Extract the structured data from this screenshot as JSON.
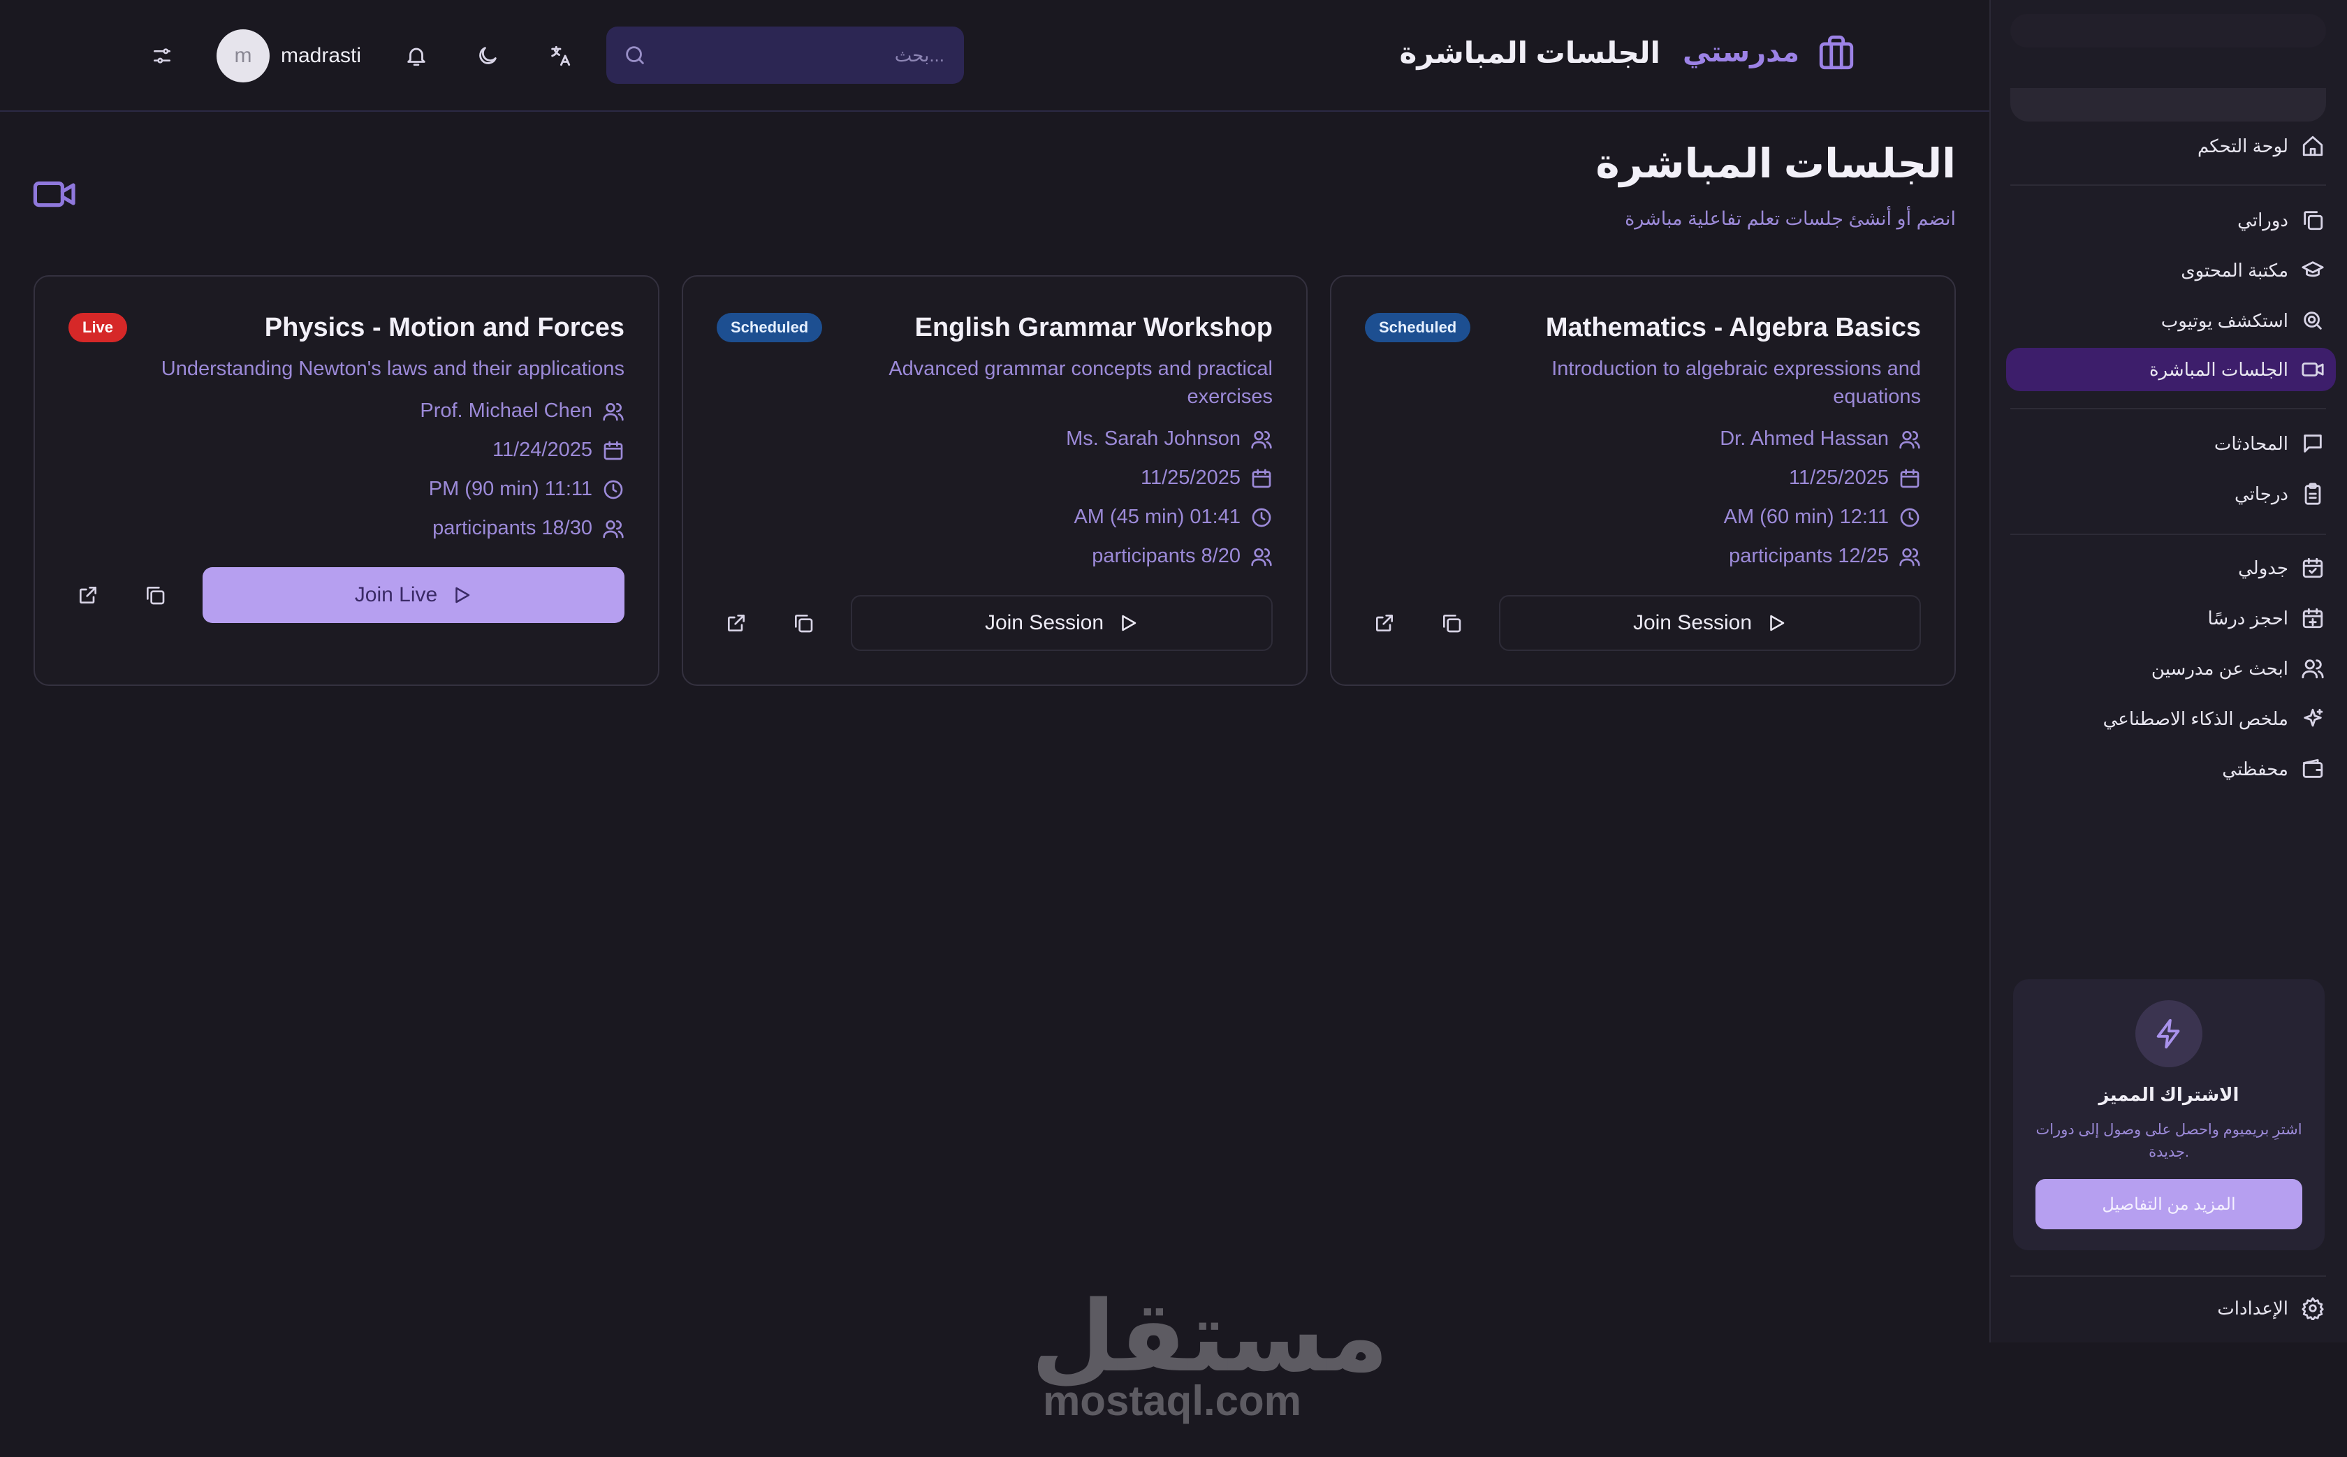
{
  "header": {
    "brand_name": "مدرستي",
    "page_title": "الجلسات المباشرة",
    "search_placeholder": "بحث...",
    "user_initial": "m",
    "user_name": "madrasti"
  },
  "sidebar": {
    "items": [
      {
        "label": "لوحة التحكم",
        "icon": "home-icon"
      },
      {
        "label": "دوراتي",
        "icon": "copy-icon"
      },
      {
        "label": "مكتبة المحتوى",
        "icon": "graduation-cap-icon"
      },
      {
        "label": "استكشف يوتيوب",
        "icon": "search-zoom-icon"
      },
      {
        "label": "الجلسات المباشرة",
        "icon": "video-icon",
        "active": true
      },
      {
        "label": "المحادثات",
        "icon": "message-icon"
      },
      {
        "label": "درجاتي",
        "icon": "clipboard-icon"
      },
      {
        "label": "جدولي",
        "icon": "calendar-check-icon"
      },
      {
        "label": "احجز درسًا",
        "icon": "calendar-plus-icon"
      },
      {
        "label": "ابحث عن مدرسين",
        "icon": "users-icon"
      },
      {
        "label": "ملخص الذكاء الاصطناعي",
        "icon": "sparkles-icon"
      },
      {
        "label": "محفظتي",
        "icon": "wallet-icon"
      }
    ],
    "promo": {
      "title": "الاشتراك المميز",
      "description": "اشترِ بريميوم واحصل على وصول إلى دورات جديدة.",
      "button": "المزيد من التفاصيل"
    },
    "settings_label": "الإعدادات"
  },
  "main": {
    "title": "الجلسات المباشرة",
    "subtitle": "انضم أو أنشئ جلسات تعلم تفاعلية مباشرة"
  },
  "sessions": [
    {
      "title": "Mathematics - Algebra Basics",
      "status": "Scheduled",
      "description": "Introduction to algebraic expressions and equations",
      "teacher": "Dr. Ahmed Hassan",
      "date": "11/25/2025",
      "time": "AM (60 min) 12:11",
      "participants": "participants 12/25",
      "button": "Join Session"
    },
    {
      "title": "English Grammar Workshop",
      "status": "Scheduled",
      "description": "Advanced grammar concepts and practical exercises",
      "teacher": "Ms. Sarah Johnson",
      "date": "11/25/2025",
      "time": "AM (45 min) 01:41",
      "participants": "participants 8/20",
      "button": "Join Session"
    },
    {
      "title": "Physics - Motion and Forces",
      "status": "Live",
      "description": "Understanding Newton's laws and their applications",
      "teacher": "Prof. Michael Chen",
      "date": "11/24/2025",
      "time": "PM (90 min) 11:11",
      "participants": "participants 18/30",
      "button": "Join Live"
    }
  ],
  "watermark": {
    "arabic": "مستقل",
    "latin": "mostaql.com"
  },
  "colors": {
    "background": "#1a1820",
    "accent": "#9c82e6",
    "live": "#d62828",
    "scheduled": "#1d4f91",
    "primary_button": "#b69ff0"
  }
}
